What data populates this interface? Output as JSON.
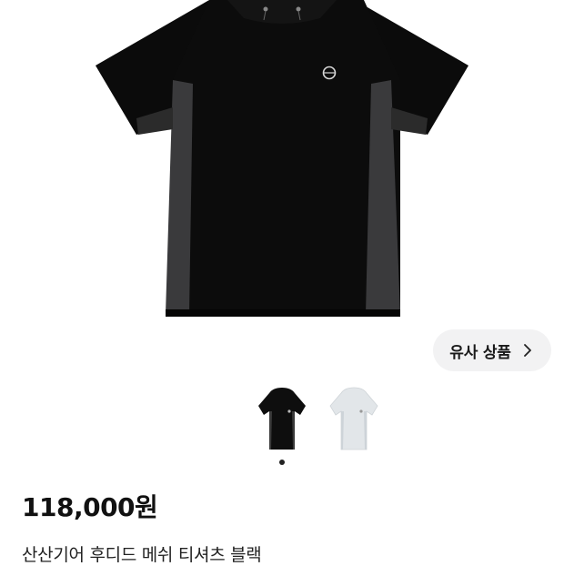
{
  "product": {
    "similar_button_label": "유사 상품",
    "price": "118,000원",
    "title": "산산기어 후디드 메쉬 티셔츠 블랙"
  },
  "gallery": {
    "main_image": "black-hooded-mesh-tshirt",
    "thumbnails": [
      {
        "name": "black",
        "color": "#111111"
      },
      {
        "name": "light-gray",
        "color": "#dfe3e6"
      }
    ],
    "active_index": 0
  },
  "icons": {
    "similar_chevron": "chevron-right-icon"
  }
}
